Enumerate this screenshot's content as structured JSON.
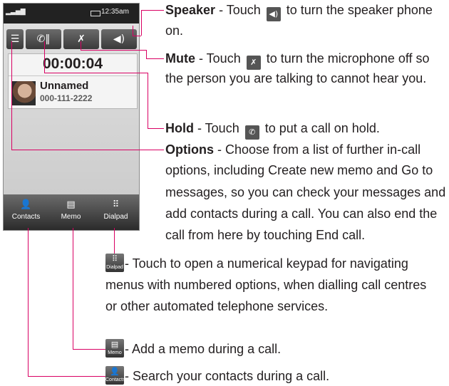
{
  "phone": {
    "status_time": "12:35am",
    "call_timer": "00:00:04",
    "caller_name": "Unnamed",
    "caller_number": "000-111-2222",
    "nav": [
      {
        "label": "Contacts",
        "icon": "contacts-icon"
      },
      {
        "label": "Memo",
        "icon": "memo-icon"
      },
      {
        "label": "Dialpad",
        "icon": "dialpad-icon"
      }
    ],
    "toolbar_icons": [
      "options-icon",
      "hold-icon",
      "mute-icon",
      "speaker-icon"
    ]
  },
  "annotations": {
    "speaker": {
      "title": "Speaker",
      "line1_pre": " - Touch ",
      "line1_post": " to turn the speaker phone",
      "line2": "on."
    },
    "mute": {
      "title": "Mute",
      "line1_pre": " - Touch ",
      "line1_post": " to turn the microphone off so",
      "line2": "the person you are talking to cannot hear you."
    },
    "hold": {
      "title": "Hold",
      "line1_pre": " - Touch ",
      "line1_post": " to put a call on hold."
    },
    "options": {
      "title": "Options",
      "line1_rest": " - Choose from a list of further in-call",
      "line2": "options, including Create new memo and Go to",
      "line3": "messages, so you can check your messages and",
      "line4": "add contacts during a call. You can also end the",
      "line5": "call from here by touching End call."
    },
    "dialpad": {
      "icon_label": "Dialpad",
      "line1": " - Touch to open a numerical keypad for navigating",
      "line2": "menus with numbered options, when dialling call centres",
      "line3": "or other automated telephone services."
    },
    "memo": {
      "icon_label": "Memo",
      "line1": " - Add a memo during a call."
    },
    "contacts": {
      "icon_label": "Contacts",
      "line1": " - Search your contacts during a call."
    }
  },
  "colors": {
    "leader_line": "#d90063",
    "text": "#231f20"
  }
}
